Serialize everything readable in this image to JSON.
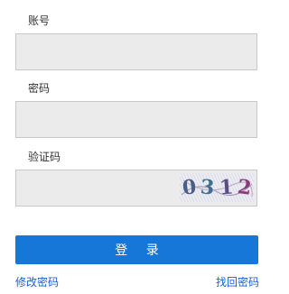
{
  "form": {
    "account": {
      "label": "账号",
      "value": "",
      "placeholder": ""
    },
    "password": {
      "label": "密码",
      "value": "",
      "placeholder": ""
    },
    "captcha": {
      "label": "验证码",
      "value": "",
      "placeholder": "",
      "image_chars": [
        "0",
        "3",
        "1",
        "2"
      ]
    }
  },
  "login_button": {
    "label": "登 录"
  },
  "links": {
    "change_password": "修改密码",
    "find_password": "找回密码"
  },
  "colors": {
    "primary": "#1677d9",
    "link": "#1a5fd4",
    "field_bg": "#ebebeb"
  }
}
